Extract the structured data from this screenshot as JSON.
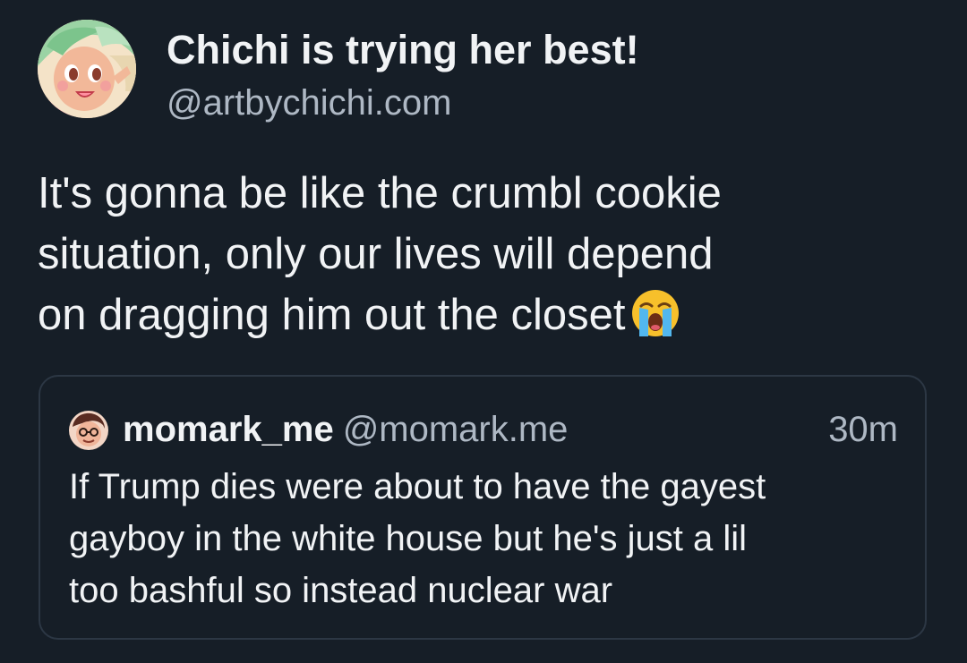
{
  "post": {
    "author": {
      "display_name": "Chichi is trying her best!",
      "handle": "@artbychichi.com",
      "avatar_icon": "anime-girl-avatar"
    },
    "text_lines": [
      "It's gonna be like the crumbl cookie",
      "situation, only our lives will depend",
      "on dragging him out the closet"
    ],
    "emoji": "loudly-crying-face-icon"
  },
  "quote": {
    "author": {
      "display_name": "momark_me",
      "handle": "@momark.me",
      "avatar_icon": "cartoon-face-avatar"
    },
    "timestamp": "30m",
    "text_lines": [
      "If Trump dies were about to have the gayest",
      "gayboy in the white house but he's just a lil",
      "too bashful so instead nuclear war"
    ]
  },
  "colors": {
    "background": "#161e27",
    "text_primary": "#f1f3f5",
    "text_secondary": "#aeb8c4",
    "card_border": "#2c3744"
  }
}
